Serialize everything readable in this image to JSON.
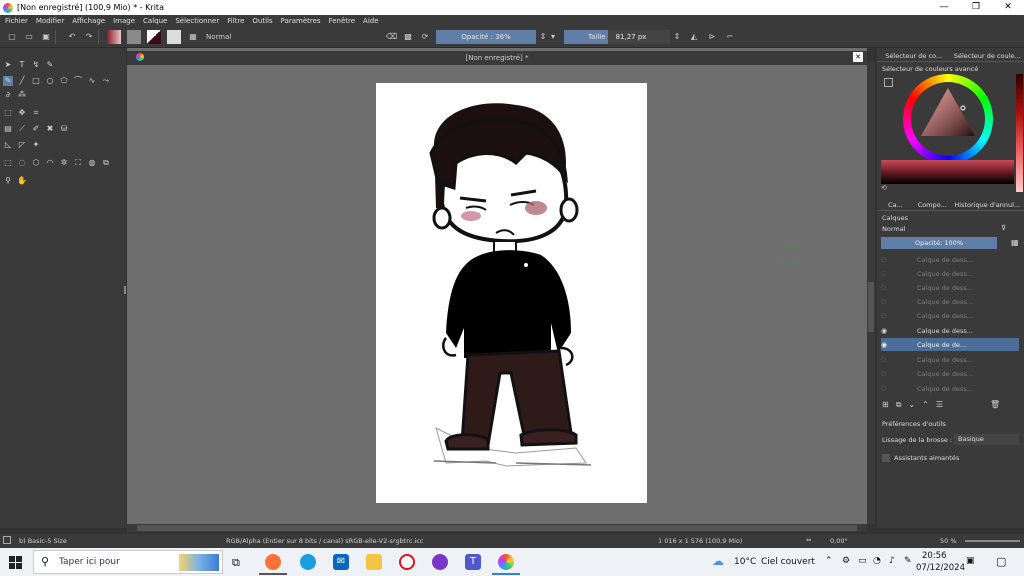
{
  "window": {
    "title": "[Non enregistré]  (100,9 Mio)  * - Krita",
    "minimize": "—",
    "maximize": "❐",
    "close": "✕"
  },
  "menu": [
    "Fichier",
    "Modifier",
    "Affichage",
    "Image",
    "Calque",
    "Sélectionner",
    "Filtre",
    "Outils",
    "Paramètres",
    "Fenêtre",
    "Aide"
  ],
  "toolbar": {
    "blend_mode": "Normal",
    "opacity_label": "Opacité : 36%",
    "opacity_value": 0.36,
    "size_label": "Taille",
    "size_value": "81,27 px"
  },
  "document": {
    "tab_title": "[Non enregistré]  *",
    "close": "✕"
  },
  "right_panel": {
    "tabs": [
      "Sélecteur de co...",
      "Sélecteur de coule..."
    ],
    "advanced_selector_title": "Sélecteur de couleurs avancé",
    "lower_tabs": [
      "Ca...",
      "Compo...",
      "Historique d'annul..."
    ],
    "layers_title": "Calques",
    "layers_blend": "Normal",
    "layers_opacity": "Opacité:  100%",
    "layers": [
      {
        "name": "Calque de dess...",
        "visible": false,
        "active": false
      },
      {
        "name": "Calque de dess...",
        "visible": false,
        "active": false
      },
      {
        "name": "Calque de dess...",
        "visible": false,
        "active": false
      },
      {
        "name": "Calque de dess...",
        "visible": false,
        "active": false
      },
      {
        "name": "Calque de dess...",
        "visible": false,
        "active": false
      },
      {
        "name": "Calque de dess...",
        "visible": true,
        "active": false
      },
      {
        "name": "Calque de de...",
        "visible": true,
        "active": true
      },
      {
        "name": "Calque de dess...",
        "visible": false,
        "active": false
      },
      {
        "name": "Calque de dess...",
        "visible": false,
        "active": false
      },
      {
        "name": "Calque de dess...",
        "visible": false,
        "active": false
      }
    ],
    "tool_prefs_title": "Préférences d'outils",
    "brush_smoothing_label": "Lissage de la brosse :",
    "brush_smoothing_value": "Basique",
    "magnetic_rulers": "Assistants aimantés"
  },
  "status": {
    "brush": "b) Basic-5 Size",
    "color_space": "RGB/Alpha (Entier sur 8 bits / canal)  sRGB-elle-V2-srgbtrc.icc",
    "dimensions": "1 016 x 1 576 (100,9 Mio)",
    "rotation": "0,00°",
    "zoom": "50 %"
  },
  "taskbar": {
    "search_placeholder": "Taper ici pour",
    "temperature": "10°C",
    "weather": "Ciel couvert",
    "time": "20:56",
    "date": "07/12/2024"
  },
  "colors": {
    "accent": "#5f7ea6",
    "panel": "#3a3a3a",
    "canvas_bg": "#6e6e6e"
  }
}
